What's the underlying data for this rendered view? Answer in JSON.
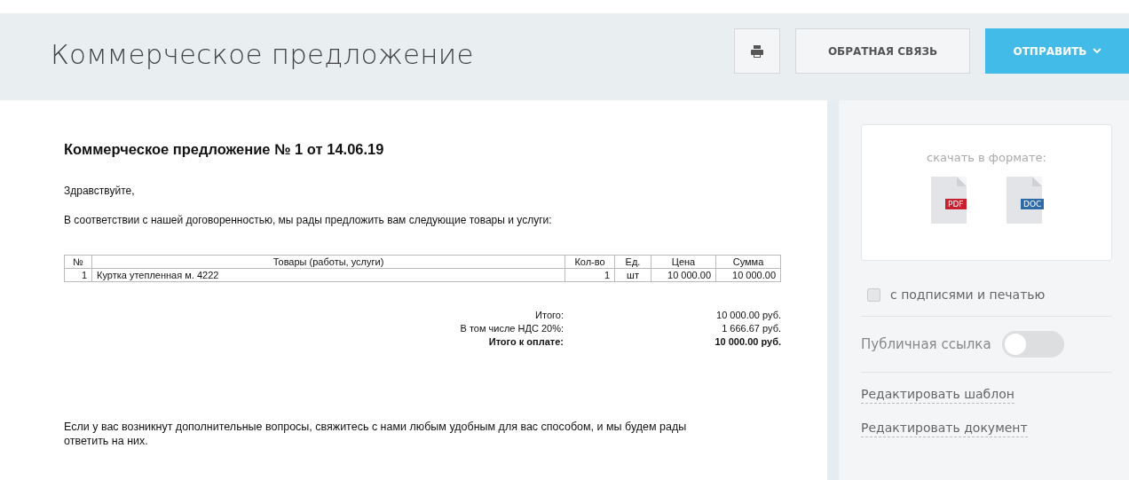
{
  "header": {
    "title": "Коммерческое предложение",
    "feedback_button": "ОБРАТНАЯ СВЯЗЬ",
    "send_button": "ОТПРАВИТЬ"
  },
  "document": {
    "heading": "Коммерческое предложение № 1 от 14.06.19",
    "greeting": "Здравствуйте,",
    "intro": "В соответствии с нашей договоренностью, мы рады предложить вам следующие товары и услуги:",
    "table": {
      "columns": [
        "№",
        "Товары (работы, услуги)",
        "Кол-во",
        "Ед.",
        "Цена",
        "Сумма"
      ],
      "rows": [
        [
          "1",
          "Куртка утепленная м. 4222",
          "1",
          "шт",
          "10 000.00",
          "10 000.00"
        ]
      ]
    },
    "totals": [
      {
        "label": "Итого:",
        "value": "10 000.00 руб.",
        "bold": false
      },
      {
        "label": "В том числе НДС 20%:",
        "value": "1 666.67 руб.",
        "bold": false
      },
      {
        "label": "Итого к оплате:",
        "value": "10 000.00 руб.",
        "bold": true
      }
    ],
    "closing": "Если у вас возникнут дополнительные вопросы, свяжитесь с нами любым удобным для вас способом, и мы будем рады ответить на них."
  },
  "sidebar": {
    "download_label": "скачать в формате:",
    "formats": [
      {
        "label": "PDF",
        "color": "#c8202f"
      },
      {
        "label": "DOC",
        "color": "#2d6aa8"
      }
    ],
    "signatures": {
      "label": "с подписями и печатью",
      "checked": false
    },
    "public_link": {
      "label": "Публичная ссылка",
      "on": false
    },
    "links": [
      "Редактировать шаблон",
      "Редактировать документ"
    ]
  }
}
